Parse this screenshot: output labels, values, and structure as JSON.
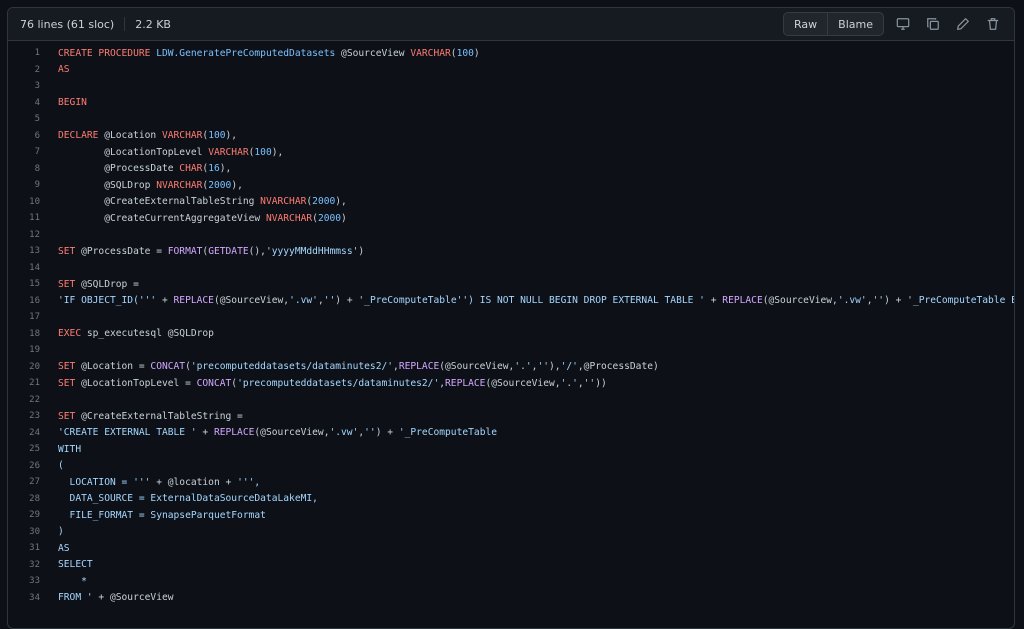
{
  "header": {
    "lines_info": "76 lines (61 sloc)",
    "size": "2.2 KB",
    "raw_label": "Raw",
    "blame_label": "Blame"
  },
  "icons": [
    "desktop-icon",
    "copy-icon",
    "pencil-icon",
    "trash-icon"
  ],
  "colors": {
    "background": "#0d1117",
    "header_bg": "#161b22",
    "keyword": "#ff7b72",
    "function": "#d2a8ff",
    "string": "#a5d6ff",
    "number": "#79c0ff",
    "text": "#c9d1d9"
  },
  "code_lines": [
    {
      "n": "1",
      "tokens": [
        {
          "t": "kw",
          "v": "CREATE PROCEDURE "
        },
        {
          "t": "ent",
          "v": "LDW.GeneratePreComputedDatasets"
        },
        {
          "t": "",
          "v": " @SourceView "
        },
        {
          "t": "kw",
          "v": "VARCHAR"
        },
        {
          "t": "",
          "v": "("
        },
        {
          "t": "num",
          "v": "100"
        },
        {
          "t": "",
          "v": ")"
        }
      ]
    },
    {
      "n": "2",
      "tokens": [
        {
          "t": "kw",
          "v": "AS"
        }
      ]
    },
    {
      "n": "3",
      "tokens": []
    },
    {
      "n": "4",
      "tokens": [
        {
          "t": "kw",
          "v": "BEGIN"
        }
      ]
    },
    {
      "n": "5",
      "tokens": []
    },
    {
      "n": "6",
      "tokens": [
        {
          "t": "kw",
          "v": "DECLARE"
        },
        {
          "t": "",
          "v": " @Location "
        },
        {
          "t": "kw",
          "v": "VARCHAR"
        },
        {
          "t": "",
          "v": "("
        },
        {
          "t": "num",
          "v": "100"
        },
        {
          "t": "",
          "v": "),"
        }
      ]
    },
    {
      "n": "7",
      "tokens": [
        {
          "t": "",
          "v": "        @LocationTopLevel "
        },
        {
          "t": "kw",
          "v": "VARCHAR"
        },
        {
          "t": "",
          "v": "("
        },
        {
          "t": "num",
          "v": "100"
        },
        {
          "t": "",
          "v": "),"
        }
      ]
    },
    {
      "n": "8",
      "tokens": [
        {
          "t": "",
          "v": "        @ProcessDate "
        },
        {
          "t": "kw",
          "v": "CHAR"
        },
        {
          "t": "",
          "v": "("
        },
        {
          "t": "num",
          "v": "16"
        },
        {
          "t": "",
          "v": "),"
        }
      ]
    },
    {
      "n": "9",
      "tokens": [
        {
          "t": "",
          "v": "        @SQLDrop "
        },
        {
          "t": "kw",
          "v": "NVARCHAR"
        },
        {
          "t": "",
          "v": "("
        },
        {
          "t": "num",
          "v": "2000"
        },
        {
          "t": "",
          "v": "),"
        }
      ]
    },
    {
      "n": "10",
      "tokens": [
        {
          "t": "",
          "v": "        @CreateExternalTableString "
        },
        {
          "t": "kw",
          "v": "NVARCHAR"
        },
        {
          "t": "",
          "v": "("
        },
        {
          "t": "num",
          "v": "2000"
        },
        {
          "t": "",
          "v": "),"
        }
      ]
    },
    {
      "n": "11",
      "tokens": [
        {
          "t": "",
          "v": "        @CreateCurrentAggregateView "
        },
        {
          "t": "kw",
          "v": "NVARCHAR"
        },
        {
          "t": "",
          "v": "("
        },
        {
          "t": "num",
          "v": "2000"
        },
        {
          "t": "",
          "v": ")"
        }
      ]
    },
    {
      "n": "12",
      "tokens": []
    },
    {
      "n": "13",
      "tokens": [
        {
          "t": "kw",
          "v": "SET"
        },
        {
          "t": "",
          "v": " @ProcessDate = "
        },
        {
          "t": "fn",
          "v": "FORMAT"
        },
        {
          "t": "",
          "v": "("
        },
        {
          "t": "fn",
          "v": "GETDATE"
        },
        {
          "t": "",
          "v": "(),"
        },
        {
          "t": "str",
          "v": "'yyyyMMddHHmmss'"
        },
        {
          "t": "",
          "v": ")"
        }
      ]
    },
    {
      "n": "14",
      "tokens": []
    },
    {
      "n": "15",
      "tokens": [
        {
          "t": "kw",
          "v": "SET"
        },
        {
          "t": "",
          "v": " @SQLDrop ="
        }
      ]
    },
    {
      "n": "16",
      "tokens": [
        {
          "t": "str",
          "v": "'IF OBJECT_ID('''"
        },
        {
          "t": "",
          "v": " + "
        },
        {
          "t": "fn",
          "v": "REPLACE"
        },
        {
          "t": "",
          "v": "(@SourceView,"
        },
        {
          "t": "str",
          "v": "'.vw'"
        },
        {
          "t": "",
          "v": ","
        },
        {
          "t": "str",
          "v": "''"
        },
        {
          "t": "",
          "v": ") + "
        },
        {
          "t": "str",
          "v": "'_PreComputeTable'') IS NOT NULL BEGIN DROP EXTERNAL TABLE '"
        },
        {
          "t": "",
          "v": " + "
        },
        {
          "t": "fn",
          "v": "REPLACE"
        },
        {
          "t": "",
          "v": "(@SourceView,"
        },
        {
          "t": "str",
          "v": "'.vw'"
        },
        {
          "t": "",
          "v": ","
        },
        {
          "t": "str",
          "v": "''"
        },
        {
          "t": "",
          "v": ") + "
        },
        {
          "t": "str",
          "v": "'_PreComputeTable END'"
        }
      ]
    },
    {
      "n": "17",
      "tokens": []
    },
    {
      "n": "18",
      "tokens": [
        {
          "t": "kw",
          "v": "EXEC"
        },
        {
          "t": "",
          "v": " sp_executesql @SQLDrop"
        }
      ]
    },
    {
      "n": "19",
      "tokens": []
    },
    {
      "n": "20",
      "tokens": [
        {
          "t": "kw",
          "v": "SET"
        },
        {
          "t": "",
          "v": " @Location = "
        },
        {
          "t": "fn",
          "v": "CONCAT"
        },
        {
          "t": "",
          "v": "("
        },
        {
          "t": "str",
          "v": "'precomputeddatasets/dataminutes2/'"
        },
        {
          "t": "",
          "v": ","
        },
        {
          "t": "fn",
          "v": "REPLACE"
        },
        {
          "t": "",
          "v": "(@SourceView,"
        },
        {
          "t": "str",
          "v": "'.'"
        },
        {
          "t": "",
          "v": ","
        },
        {
          "t": "str",
          "v": "''"
        },
        {
          "t": "",
          "v": "),"
        },
        {
          "t": "str",
          "v": "'/'"
        },
        {
          "t": "",
          "v": ",@ProcessDate)"
        }
      ]
    },
    {
      "n": "21",
      "tokens": [
        {
          "t": "kw",
          "v": "SET"
        },
        {
          "t": "",
          "v": " @LocationTopLevel = "
        },
        {
          "t": "fn",
          "v": "CONCAT"
        },
        {
          "t": "",
          "v": "("
        },
        {
          "t": "str",
          "v": "'precomputeddatasets/dataminutes2/'"
        },
        {
          "t": "",
          "v": ","
        },
        {
          "t": "fn",
          "v": "REPLACE"
        },
        {
          "t": "",
          "v": "(@SourceView,"
        },
        {
          "t": "str",
          "v": "'.'"
        },
        {
          "t": "",
          "v": ","
        },
        {
          "t": "str",
          "v": "''"
        },
        {
          "t": "",
          "v": "))"
        }
      ]
    },
    {
      "n": "22",
      "tokens": []
    },
    {
      "n": "23",
      "tokens": [
        {
          "t": "kw",
          "v": "SET"
        },
        {
          "t": "",
          "v": " @CreateExternalTableString ="
        }
      ]
    },
    {
      "n": "24",
      "tokens": [
        {
          "t": "str",
          "v": "'CREATE EXTERNAL TABLE '"
        },
        {
          "t": "",
          "v": " + "
        },
        {
          "t": "fn",
          "v": "REPLACE"
        },
        {
          "t": "",
          "v": "(@SourceView,"
        },
        {
          "t": "str",
          "v": "'.vw'"
        },
        {
          "t": "",
          "v": ","
        },
        {
          "t": "str",
          "v": "''"
        },
        {
          "t": "",
          "v": ") + "
        },
        {
          "t": "str",
          "v": "'_PreComputeTable"
        }
      ]
    },
    {
      "n": "25",
      "tokens": [
        {
          "t": "str",
          "v": "WITH"
        }
      ]
    },
    {
      "n": "26",
      "tokens": [
        {
          "t": "str",
          "v": "("
        }
      ]
    },
    {
      "n": "27",
      "tokens": [
        {
          "t": "str",
          "v": "  LOCATION = '''"
        },
        {
          "t": "",
          "v": " + @location + "
        },
        {
          "t": "str",
          "v": "''',"
        }
      ]
    },
    {
      "n": "28",
      "tokens": [
        {
          "t": "str",
          "v": "  DATA_SOURCE = ExternalDataSourceDataLakeMI,"
        }
      ]
    },
    {
      "n": "29",
      "tokens": [
        {
          "t": "str",
          "v": "  FILE_FORMAT = SynapseParquetFormat"
        }
      ]
    },
    {
      "n": "30",
      "tokens": [
        {
          "t": "str",
          "v": ")"
        }
      ]
    },
    {
      "n": "31",
      "tokens": [
        {
          "t": "str",
          "v": "AS"
        }
      ]
    },
    {
      "n": "32",
      "tokens": [
        {
          "t": "str",
          "v": "SELECT"
        }
      ]
    },
    {
      "n": "33",
      "tokens": [
        {
          "t": "str",
          "v": "    *"
        }
      ]
    },
    {
      "n": "34",
      "tokens": [
        {
          "t": "str",
          "v": "FROM '"
        },
        {
          "t": "",
          "v": " + @SourceView"
        }
      ]
    }
  ]
}
